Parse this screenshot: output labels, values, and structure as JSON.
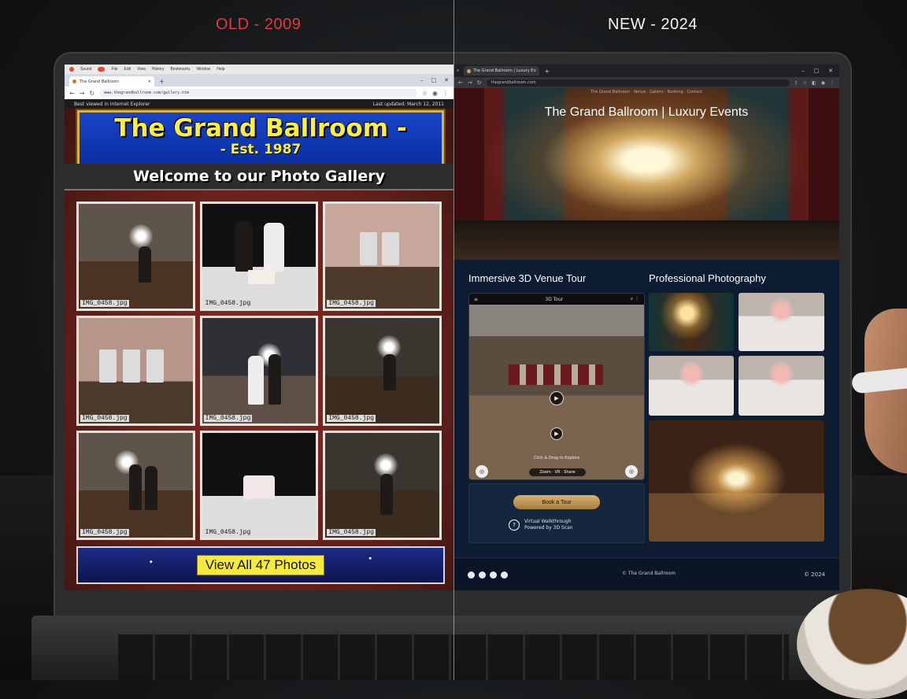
{
  "labels": {
    "old": "OLD - 2009",
    "new": "NEW - 2024"
  },
  "old_site": {
    "menubar": [
      "Sound",
      "File",
      "Edit",
      "View",
      "History",
      "Bookmarks",
      "Window",
      "Help"
    ],
    "tab_title": "The Grand Ballroom",
    "url": "www.thegrandballroom.com/gallery.htm",
    "top_left": "Best viewed in Internet Explorer",
    "last_updated": "Last updated: March 12, 2011",
    "banner_title": "The Grand Ballroom -",
    "banner_subtitle": "- Est. 1987",
    "welcome": "Welcome to our Photo Gallery",
    "photos": [
      {
        "caption": "IMG_0458.jpg"
      },
      {
        "caption": "IMG_0458.jpg"
      },
      {
        "caption": "IMG_0458.jpg"
      },
      {
        "caption": "IMG_0458.jpg"
      },
      {
        "caption": "IMG_0458.jpg"
      },
      {
        "caption": "IMG_0458.jpg"
      },
      {
        "caption": "IMG_0458.jpg"
      },
      {
        "caption": "IMG_0458.jpg"
      },
      {
        "caption": "IMG_0458.jpg"
      }
    ],
    "view_all_button": "View All 47 Photos"
  },
  "new_site": {
    "tab_title": "The Grand Ballroom | Luxury Events",
    "url": "thegrandballroom.com",
    "top_nav": "The Grand Ballroom · Venue · Gallery · Booking · Contact",
    "hero_title": "The Grand Ballroom | Luxury Events",
    "tour_section_title": "Immersive 3D Venue Tour",
    "photo_section_title": "Professional Photography",
    "tour_header": "3D Tour",
    "tour_hint": "Click & Drag to Explore",
    "tour_controls": "Zoom · VR · Share",
    "book_button": "Book a Tour",
    "book_note_line1": "Virtual Walkthrough",
    "book_note_line2": "Powered by 3D Scan",
    "footer_center": "© The Grand Ballroom",
    "footer_year": "© 2024"
  }
}
